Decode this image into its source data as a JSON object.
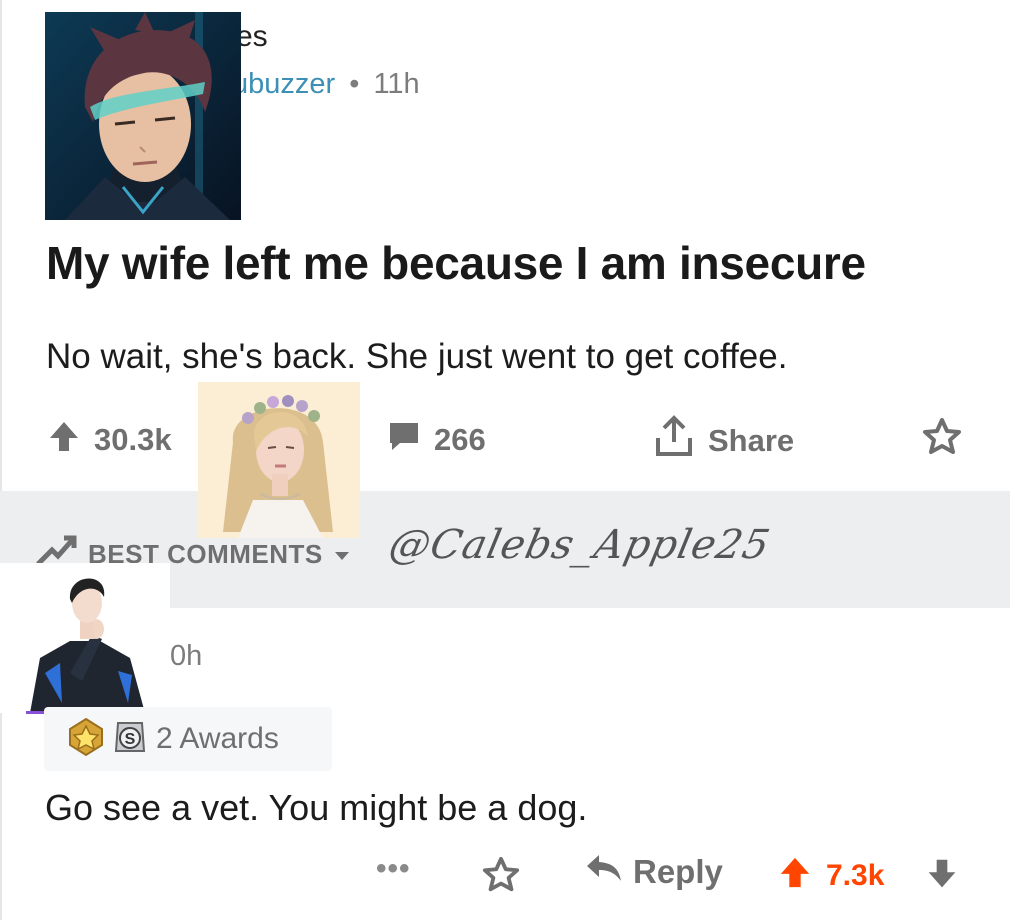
{
  "post": {
    "subreddit_fragment": "es",
    "user_fragment": "ubuzzer",
    "separator": "•",
    "time": "11h",
    "title": "My wife left me because I am insecure",
    "body": "No wait, she's back. She just went to get coffee.",
    "upvotes": "30.3k",
    "comment_count": "266",
    "share_label": "Share"
  },
  "comments_section": {
    "sort_label": "BEST COMMENTS",
    "watermark": "@Calebs_Apple25"
  },
  "comment": {
    "time": "0h",
    "awards_label": "2 Awards",
    "body": "Go see a vet. You might be a dog.",
    "more_label": "•••",
    "reply_label": "Reply",
    "score": "7.3k"
  },
  "colors": {
    "upvote_active": "#ff4500",
    "username": "#3c8fb5",
    "meta_grey": "#7c7c7c",
    "band_grey": "#edeef0"
  },
  "icons": [
    "upvote-icon",
    "comment-bubble-icon",
    "share-icon",
    "star-icon",
    "sort-icon",
    "chevron-down-icon",
    "gold-award-icon",
    "silver-award-icon",
    "reply-arrow-icon",
    "downvote-icon"
  ]
}
